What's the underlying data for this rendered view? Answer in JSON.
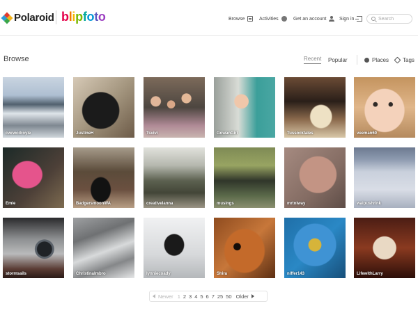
{
  "header": {
    "brand_polaroid": "Polaroid",
    "brand_blipfoto": [
      "b",
      "l",
      "i",
      "p",
      "f",
      "o",
      "t",
      "o"
    ],
    "nav": {
      "browse": "Browse",
      "activities": "Activities",
      "get_account": "Get an account",
      "sign_in": "Sign in"
    },
    "search_placeholder": "Search"
  },
  "page": {
    "title": "Browse",
    "tabs": {
      "recent": "Recent",
      "popular": "Popular",
      "places": "Places",
      "tags": "Tags"
    },
    "active_tab": "Recent"
  },
  "photos": [
    {
      "user": "cwrwcdroyle"
    },
    {
      "user": "JustineH"
    },
    {
      "user": "Tsvivi"
    },
    {
      "user": "GowanGirl"
    },
    {
      "user": "Tussocktales"
    },
    {
      "user": "veeman60"
    },
    {
      "user": "Emie"
    },
    {
      "user": "BadgersmoonWA"
    },
    {
      "user": "creativelanna"
    },
    {
      "user": "musings"
    },
    {
      "user": "mrtniway"
    },
    {
      "user": "waipushrink"
    },
    {
      "user": "stormsails"
    },
    {
      "user": "ChristinaImbro"
    },
    {
      "user": "lynniecoady"
    },
    {
      "user": "Shira"
    },
    {
      "user": "niffer143"
    },
    {
      "user": "LifewithLarry"
    }
  ],
  "pagination": {
    "newer": "Newer",
    "pages": [
      "1",
      "2",
      "3",
      "4",
      "5",
      "6",
      "7",
      "25",
      "50"
    ],
    "current": "1",
    "older": "Older"
  },
  "colors": {
    "blipfoto": [
      "#e4004a",
      "#f07b00",
      "#f5b800",
      "#7ab800",
      "#00a89d",
      "#0096d6",
      "#5b5bc0",
      "#9b3dc0"
    ],
    "polaroid_mark": [
      "#e23b2e",
      "#f5b41a",
      "#2c9ad8",
      "#3aa64a"
    ]
  }
}
